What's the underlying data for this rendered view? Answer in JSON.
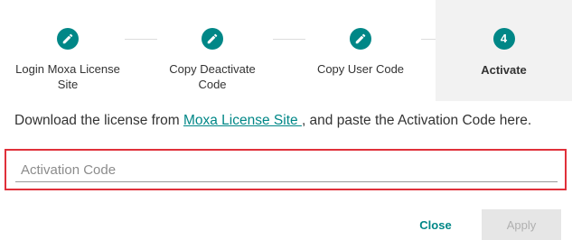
{
  "stepper": {
    "steps": [
      {
        "label_line1": "Login Moxa License",
        "label_line2": "Site",
        "icon": "pencil-icon"
      },
      {
        "label_line1": "Copy Deactivate",
        "label_line2": "Code",
        "icon": "pencil-icon"
      },
      {
        "label_line1": "Copy User Code",
        "label_line2": "",
        "icon": "pencil-icon"
      },
      {
        "label_line1": "Activate",
        "label_line2": "",
        "number": "4"
      }
    ],
    "active_step": 4
  },
  "instruction": {
    "prefix": "Download the license from ",
    "link": "Moxa License Site ",
    "suffix": ", and paste the Activation Code here."
  },
  "activation_input": {
    "placeholder": "Activation Code",
    "value": ""
  },
  "actions": {
    "close_label": "Close",
    "apply_label": "Apply"
  },
  "colors": {
    "accent": "#008787",
    "highlight_border": "#e0303a",
    "active_step_bg": "#f2f2f2"
  }
}
